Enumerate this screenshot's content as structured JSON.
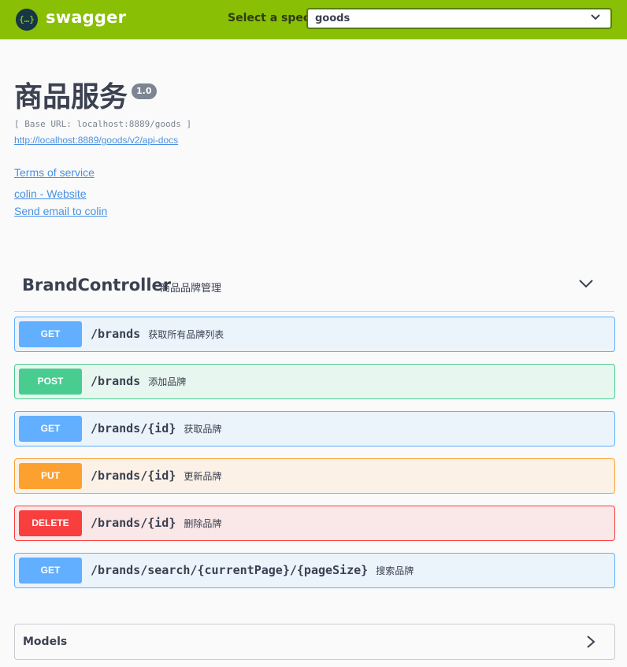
{
  "topbar": {
    "logo_text": "swagger",
    "logo_glyph": "{…}",
    "spec_label": "Select a spec",
    "spec_value": "goods",
    "brand_color": "#89bf04"
  },
  "info": {
    "title": "商品服务",
    "version": "1.0",
    "base_url": "[ Base URL: localhost:8889/goods ]",
    "api_docs_link": "http://localhost:8889/goods/v2/api-docs",
    "terms": "Terms of service",
    "website": "colin - Website",
    "email": "Send email to colin"
  },
  "tag": {
    "name": "BrandController",
    "description": "商品品牌管理",
    "icon": "chevron-down-icon"
  },
  "operations": [
    {
      "method": "GET",
      "path": "/brands",
      "summary": "获取所有品牌列表",
      "color": "#61affe"
    },
    {
      "method": "POST",
      "path": "/brands",
      "summary": "添加品牌",
      "color": "#49cc90"
    },
    {
      "method": "GET",
      "path": "/brands/{id}",
      "summary": "获取品牌",
      "color": "#61affe"
    },
    {
      "method": "PUT",
      "path": "/brands/{id}",
      "summary": "更新品牌",
      "color": "#fca130"
    },
    {
      "method": "DELETE",
      "path": "/brands/{id}",
      "summary": "删除品牌",
      "color": "#f93e3e"
    },
    {
      "method": "GET",
      "path": "/brands/search/{currentPage}/{pageSize}",
      "summary": "搜索品牌",
      "color": "#61affe"
    }
  ],
  "models": {
    "label": "Models",
    "icon": "chevron-right-icon"
  }
}
